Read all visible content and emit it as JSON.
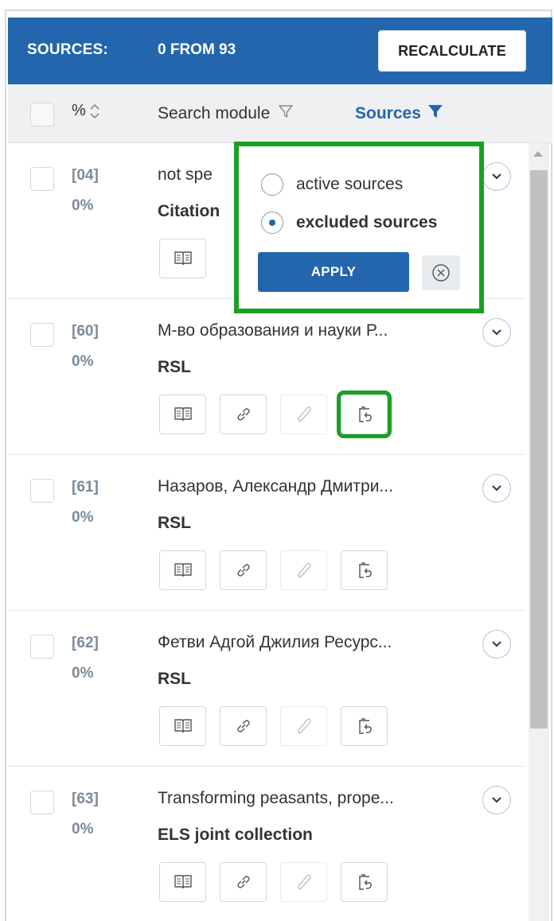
{
  "header": {
    "label": "SOURCES:",
    "count": "0 FROM 93",
    "recalculate_label": "RECALCULATE"
  },
  "toolbar": {
    "percent_label": "%",
    "search_module_label": "Search module",
    "sources_label": "Sources"
  },
  "filter_popup": {
    "options": [
      {
        "label": "active sources",
        "selected": false
      },
      {
        "label": "excluded sources",
        "selected": true
      }
    ],
    "apply_label": "APPLY"
  },
  "rows": [
    {
      "num": "[04]",
      "pct": "0%",
      "title": "not spe",
      "sub": "Citation"
    },
    {
      "num": "[60]",
      "pct": "0%",
      "title": "М-во образования и науки Р...",
      "sub": "RSL"
    },
    {
      "num": "[61]",
      "pct": "0%",
      "title": "Назаров, Александр Дмитри...",
      "sub": "RSL"
    },
    {
      "num": "[62]",
      "pct": "0%",
      "title": "Фетви Адгой Джилия Ресурс...",
      "sub": "RSL"
    },
    {
      "num": "[63]",
      "pct": "0%",
      "title": "Transforming peasants, prope...",
      "sub": "ELS joint collection"
    }
  ],
  "colors": {
    "header_bg": "#2466ad",
    "highlight": "#1aa024",
    "accent": "#2466ad"
  },
  "icons": [
    "book-icon",
    "link-icon",
    "pencil-icon",
    "restore-icon",
    "chevron-down-icon",
    "filter-icon",
    "close-icon"
  ]
}
